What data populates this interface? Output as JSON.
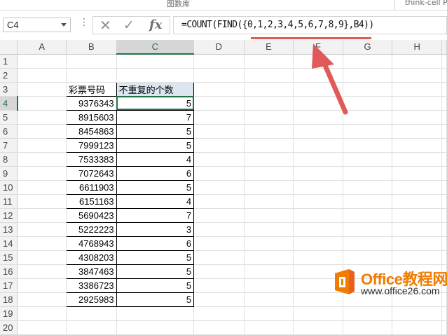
{
  "ribbon": {
    "group_label_1": "图数库",
    "group_label_2": "think-cell P"
  },
  "formula_bar": {
    "name_box": "C4",
    "formula": "=COUNT(FIND({0,1,2,3,4,5,6,7,8,9},B4))"
  },
  "sheet": {
    "columns": [
      "A",
      "B",
      "C",
      "D",
      "E",
      "F",
      "G",
      "H"
    ],
    "rows": [
      "1",
      "2",
      "3",
      "4",
      "5",
      "6",
      "7",
      "8",
      "9",
      "10",
      "11",
      "12",
      "13",
      "14",
      "15",
      "16",
      "17",
      "18",
      "19",
      "20"
    ],
    "headers": {
      "b3": "彩票号码",
      "c3": "不重复的个数"
    },
    "data": [
      {
        "row": "4",
        "b": "9376343",
        "c": "5"
      },
      {
        "row": "5",
        "b": "8915603",
        "c": "7"
      },
      {
        "row": "6",
        "b": "8454863",
        "c": "5"
      },
      {
        "row": "7",
        "b": "7999123",
        "c": "5"
      },
      {
        "row": "8",
        "b": "7533383",
        "c": "4"
      },
      {
        "row": "9",
        "b": "7072643",
        "c": "6"
      },
      {
        "row": "10",
        "b": "6611903",
        "c": "5"
      },
      {
        "row": "11",
        "b": "6151163",
        "c": "4"
      },
      {
        "row": "12",
        "b": "5690423",
        "c": "7"
      },
      {
        "row": "13",
        "b": "5222223",
        "c": "3"
      },
      {
        "row": "14",
        "b": "4768943",
        "c": "6"
      },
      {
        "row": "15",
        "b": "4308203",
        "c": "5"
      },
      {
        "row": "16",
        "b": "3847463",
        "c": "5"
      },
      {
        "row": "17",
        "b": "3386723",
        "c": "5"
      },
      {
        "row": "18",
        "b": "2925983",
        "c": "5"
      }
    ]
  },
  "watermark": {
    "brand": "Office教程网",
    "url": "www.office26.com"
  },
  "colors": {
    "accent": "#217346",
    "annotation": "#e05a5a",
    "header_fill": "#dce6f1",
    "logo_orange": "#f07c00"
  }
}
